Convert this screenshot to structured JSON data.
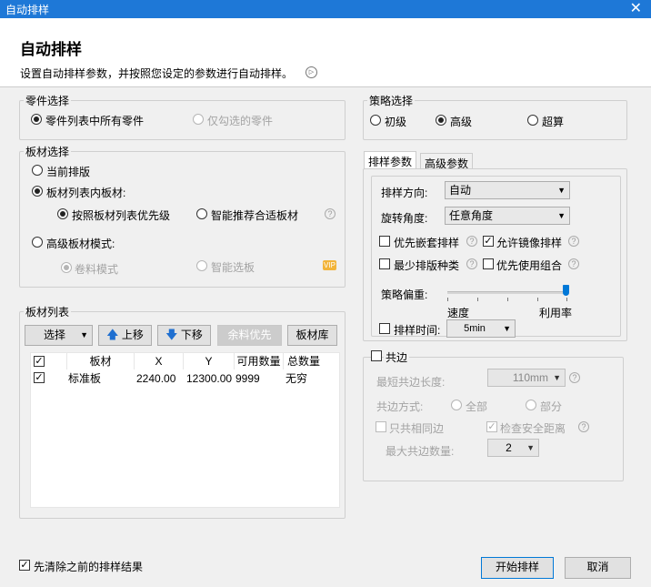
{
  "window": {
    "title": "自动排样",
    "close_glyph": "✕"
  },
  "header": {
    "title": "自动排样",
    "subtitle": "设置自动排样参数，并按照您设定的参数进行自动排样。"
  },
  "parts": {
    "legend": "零件选择",
    "all_parts": "零件列表中所有零件",
    "checked_parts": "仅勾选的零件"
  },
  "plates": {
    "legend": "板材选择",
    "current": "当前排版",
    "in_list": "板材列表内板材:",
    "by_priority": "按照板材列表优先级",
    "smart_recommend": "智能推荐合适板材",
    "advanced_mode": "高级板材模式:",
    "roll_mode": "卷料模式",
    "smart_select": "智能选板",
    "vip_badge": "VIP"
  },
  "plate_list": {
    "legend": "板材列表",
    "select_btn": "选择",
    "move_up_btn": "上移",
    "move_down_btn": "下移",
    "remnant_btn": "余料优先",
    "library_btn": "板材库",
    "columns": [
      "板材",
      "X",
      "Y",
      "可用数量",
      "总数量"
    ],
    "rows": [
      {
        "checked": "✓",
        "name": "标准板",
        "x": "2240.00",
        "y": "12300.00",
        "available": "9999",
        "total": "无穷"
      }
    ],
    "header_check": "✓"
  },
  "strategy": {
    "legend": "策略选择",
    "basic": "初级",
    "advanced": "高级",
    "super": "超算"
  },
  "tabs": {
    "nest_params": "排样参数",
    "advanced_params": "高级参数"
  },
  "nest_params": {
    "direction_label": "排样方向:",
    "direction_value": "自动",
    "rotation_label": "旋转角度:",
    "rotation_value": "任意角度",
    "prefer_embed": "优先嵌套排样",
    "allow_mirror": "允许镜像排样",
    "min_plate_types": "最少排版种类",
    "prefer_combo": "优先使用组合",
    "bias_label": "策略偏重:",
    "speed": "速度",
    "utilization": "利用率",
    "bias_level": 1.0,
    "time_label": "排样时间:",
    "time_value": "5min"
  },
  "common_edge": {
    "label": "共边",
    "min_len_label": "最短共边长度:",
    "min_len_value": "110mm",
    "mode_label": "共边方式:",
    "mode_all": "全部",
    "mode_part": "部分",
    "same_only": "只共相同边",
    "check_safety": "检查安全距离",
    "max_count_label": "最大共边数量:",
    "max_count_value": "2"
  },
  "footer": {
    "clear_previous": "先清除之前的排样结果",
    "start_btn": "开始排样",
    "cancel_btn": "取消"
  },
  "glyphs": {
    "check": "✓",
    "dropdown": "▼",
    "help": "?",
    "arrow_up": "🡅",
    "arrow_down": "🡇",
    "play": "▷"
  }
}
